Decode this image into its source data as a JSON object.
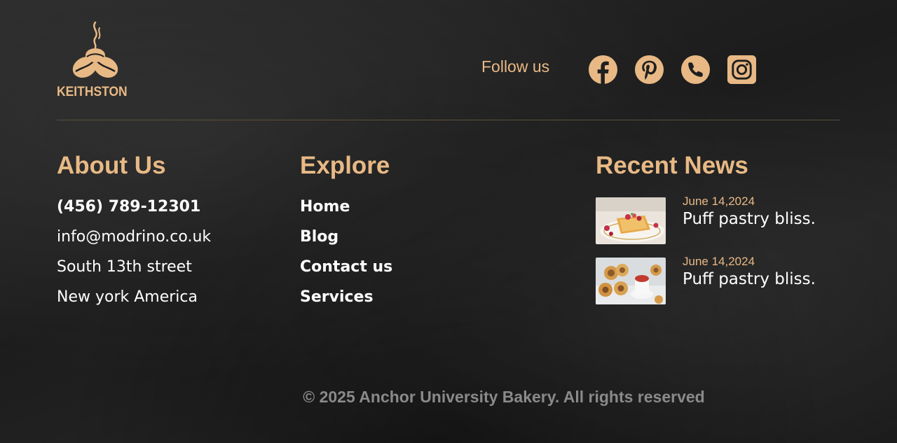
{
  "brand": {
    "name": "KEITHSTON",
    "logo_icon": "coffee-beans-steam-icon"
  },
  "follow": {
    "label": "Follow us",
    "icons": [
      "facebook-icon",
      "pinterest-icon",
      "phone-icon",
      "instagram-icon"
    ]
  },
  "colors": {
    "accent": "#e8b985",
    "text": "#ffffff",
    "muted": "#8a8a8a",
    "background": "#1f1f1f"
  },
  "about": {
    "title": "About Us",
    "phone": "(456) 789-12301",
    "email": "info@modrino.co.uk",
    "street": "South 13th street",
    "city": "New york America"
  },
  "explore": {
    "title": "Explore",
    "links": [
      "Home",
      "Blog",
      "Contact us",
      "Services"
    ]
  },
  "news": {
    "title": "Recent News",
    "items": [
      {
        "date": "June 14,2024",
        "title": "Puff pastry bliss."
      },
      {
        "date": "June 14,2024",
        "title": "Puff pastry bliss."
      }
    ]
  },
  "footer": {
    "copyright": "© 2025 Anchor University Bakery. All rights reserved"
  }
}
